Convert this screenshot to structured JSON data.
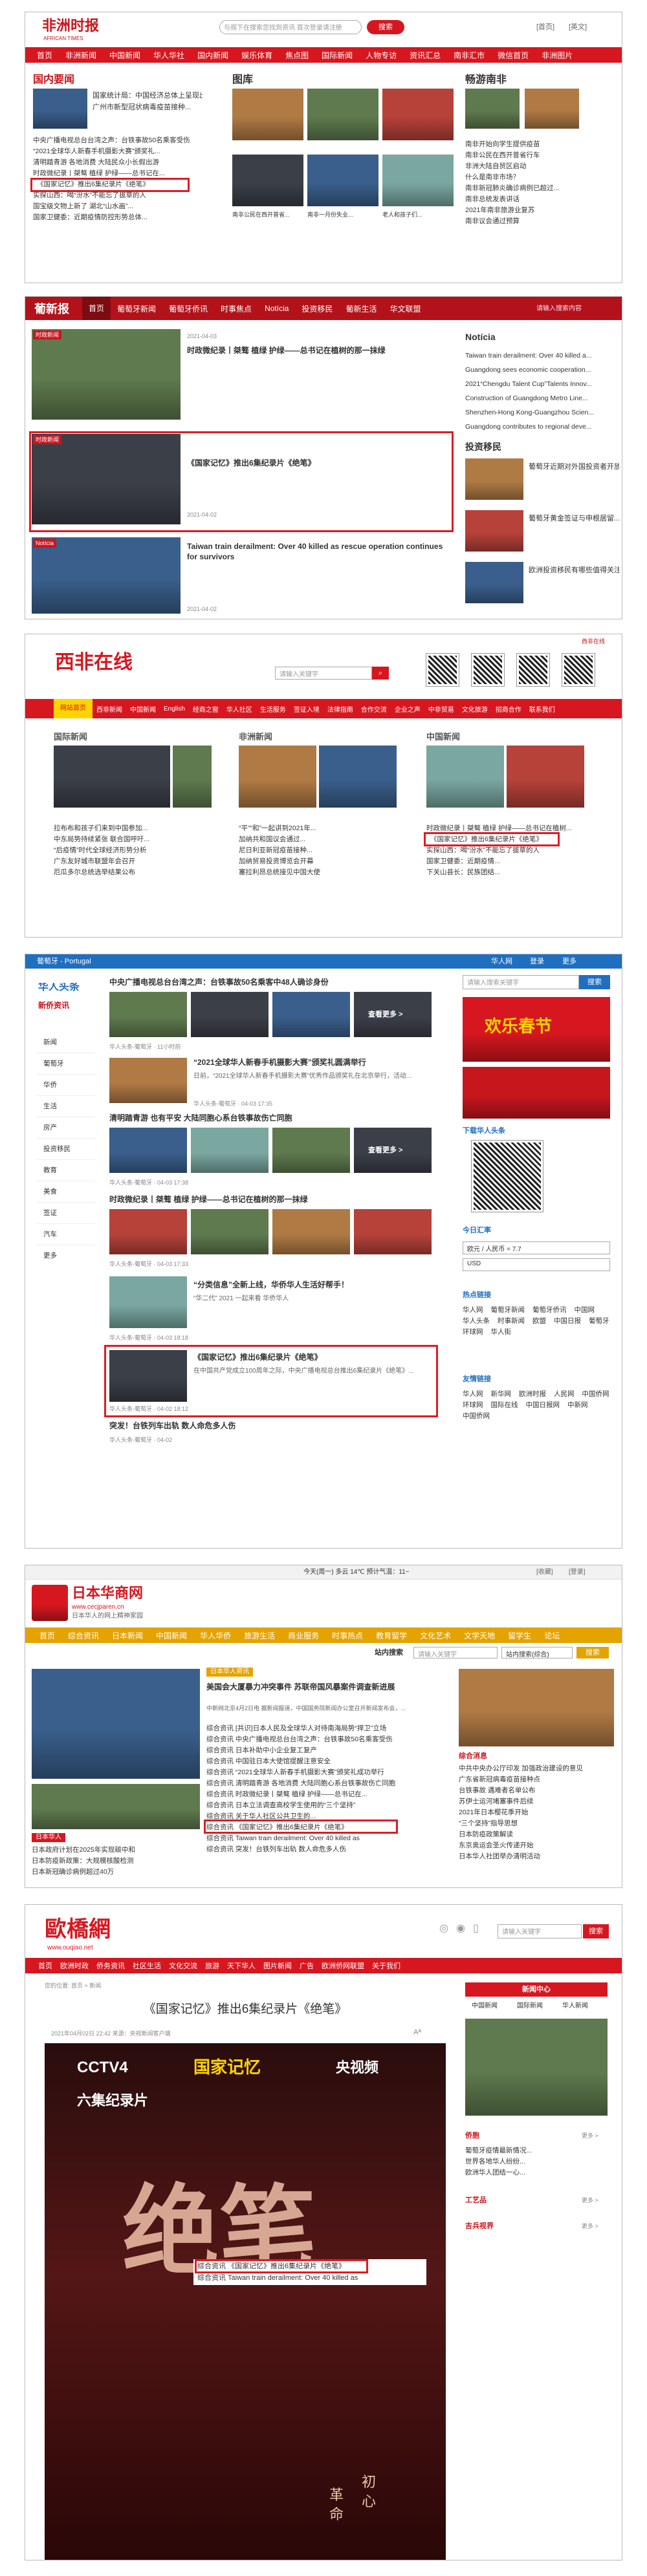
{
  "p1": {
    "logo_cn": "非洲时报",
    "logo_en": "AFRICAN TIMES",
    "search_placeholder": "与阁下在搜索您找到资讯 首次登录请注册",
    "search_btn": "搜索",
    "top_links": [
      "[首页]",
      "[英文]"
    ],
    "nav": [
      "首页",
      "非洲新闻",
      "中国新闻",
      "华人华社",
      "国内新闻",
      "娱乐体育",
      "焦点图",
      "国际新闻",
      "人物专访",
      "资讯汇总",
      "南非汇市",
      "微信首页",
      "非洲图片"
    ],
    "sec_a": "国内要闻",
    "sec_b": "图库",
    "sec_c": "畅游南非",
    "caption_a1": "国家统计局：中国经济总体上呈现出...",
    "caption_a2": "广州市新型冠状病毒疫苗接种...",
    "list_a": [
      "中央广播电视总台台湾之声：台铁事故50名乘客受伤",
      "“2021全球华人新春手机摄影大赛”颁奖礼...",
      "清明踏青游 各地消费 大陆民众小长假出游",
      "时政微纪录丨桀骜 植绿 护绿——总书记在...",
      "《国家记忆》推出6集纪录片《绝笔》",
      "实探山西：喝“汾水”不能忘了拔草的人",
      "国宝级文物上新了 湖北“山水画”...",
      "国家卫健委：近期疫情防控形势总体..."
    ],
    "mid_caps": [
      "南非公民在西开普省...",
      "南非一月份失业...",
      "老人和孩子们..."
    ],
    "list_c": [
      "南非开始向学生提供疫苗",
      "南非公民在西开普省行车",
      "非洲大陆自贸区启动",
      "什么是南非市场？",
      "南非新冠肺炎确诊病例已超过...",
      "南非总统发表讲话",
      "2021年南非旅游业复苏",
      "南非议会通过预算"
    ]
  },
  "p2": {
    "logo": "葡新报",
    "nav": [
      "首页",
      "葡萄牙新闻",
      "葡萄牙侨讯",
      "时事焦点",
      "Notícia",
      "投资移民",
      "葡新生活",
      "华文联盟"
    ],
    "nav_right": "请输入搜索内容",
    "a1_title": "时政微纪录丨桀骜 植绿 护绿——总书记在植树的那一抹绿",
    "a1_date": "2021-04-03",
    "a2_title": "《国家记忆》推出6集纪录片《绝笔》",
    "a2_date": "2021-04-02",
    "a3_title": "Taiwan train derailment: Over 40 killed as rescue operation continues for survivors",
    "a3_date": "2021-04-02",
    "tag_a": "时政新闻",
    "tag_c": "Notícia",
    "side_title": "Notícia",
    "side_list": [
      "Taiwan train derailment: Over 40 killed a...",
      "Guangdong sees economic cooperation...",
      "2021“Chengdu Talent Cup”Talents Innov...",
      "Construction of Guangdong Metro Line...",
      "Shenzhen-Hong Kong-Guangzhou Scien...",
      "Guangdong contributes to regional deve..."
    ],
    "side2_title": "投资移民",
    "side2_list": [
      "葡萄牙近期对外国投资者开放了...",
      "葡萄牙黄金签证与申根居留...",
      "欧洲投资移民有哪些值得关注的..."
    ]
  },
  "p3": {
    "logo": "西非在线",
    "top_tag": "西非在线",
    "search_placeholder": "请输入关键字",
    "nav": [
      "网站首页",
      "西非新闻",
      "中国新闻",
      "English",
      "经商之窗",
      "华人社区",
      "生活服务",
      "签证入境",
      "法律指南",
      "合作交流",
      "企业之声",
      "中非贸易",
      "文化旅游",
      "招商合作",
      "联系我们"
    ],
    "sec_a": "国际新闻",
    "sec_b": "非洲新闻",
    "sec_c": "中国新闻",
    "list_a": [
      "拉布布和孩子们来到中国参加...",
      "中东局势持续紧张 联合国呼吁...",
      "“后疫情”时代全球经济形势分析",
      "广东友好城市联盟年会召开",
      "厄瓜多尔总统选举结果公布"
    ],
    "list_b": [
      "“平”“和”一起讲到2021年...",
      "加纳共和国议会通过...",
      "尼日利亚新冠疫苗接种...",
      "加纳贸易投资博览会开幕",
      "塞拉利昂总统接见中国大使"
    ],
    "list_c": [
      "时政微纪录丨桀骜 植绿 护绿——总书记在植树...",
      "《国家记忆》推出6集纪录片《绝笔》",
      "实探山西：喝“汾水”不能忘了拔草的人",
      "国家卫健委：近期疫情...",
      "下关山县长：民族团结..."
    ]
  },
  "p4": {
    "logo": "葡萄牙 - Portugal",
    "top_right": [
      "华人网",
      "登录",
      "更多"
    ],
    "side_logo": "华人头条",
    "side_logo2": "新侨资讯",
    "side_menu": [
      "新闻",
      "葡萄牙",
      "华侨",
      "生活",
      "房产",
      "投资移民",
      "教育",
      "美食",
      "签证",
      "汽车",
      "更多"
    ],
    "items": [
      {
        "title": "中央广播电视总台台湾之声：台铁事故50名乘客中48人确诊身份",
        "meta": "华人头条-葡萄牙 · 11小时前",
        "more": "查看更多 >"
      },
      {
        "title": "“2021全球华人新春手机摄影大赛”颁奖礼圆满举行",
        "desc": "日前，“2021全球华人新春手机摄影大赛”优秀作品颁奖礼在北京举行，活动...",
        "meta": "华人头条-葡萄牙 · 04-03 17:35"
      },
      {
        "title": "清明踏青游 也有平安 大陆同胞心系台铁事故伤亡同胞",
        "meta": "华人头条-葡萄牙 · 04-03 17:38",
        "more": "查看更多 >"
      },
      {
        "title": "时政微纪录丨桀骜 植绿 护绿——总书记在植树的那一抹绿",
        "meta": "华人头条-葡萄牙 · 04-03 17:33"
      },
      {
        "title": "“华二代” 2021 一起来看 华侨华人",
        "desc": "“分类信息”全新上线，华侨华人生活好帮手！",
        "meta": "华人头条-葡萄牙 · 04-03 18:18"
      },
      {
        "title": "《国家记忆》推出6集纪录片《绝笔》",
        "desc": "在中国共产党成立100周年之际，中央广播电视总台推出6集纪录片《绝笔》...",
        "meta": "华人头条-葡萄牙 · 04-02 18:12"
      },
      {
        "title": "突发！台铁列车出轨 数人命危多人伤",
        "meta": "华人头条-葡萄牙 · 04-02"
      }
    ],
    "search_placeholder": "请输入搜索关键字",
    "search_btn": "搜索",
    "ad_text": "欢乐春节",
    "qr_label": "下载华人头条",
    "rate_title": "今日汇率",
    "rate_rows": [
      "欧元 / 人民币 = 7.7",
      "USD"
    ],
    "hot_title": "热点链接",
    "hot_links": [
      "华人网",
      "葡萄牙新闻",
      "葡萄牙侨讯",
      "中国网",
      "华人头条",
      "时事新闻",
      "欧盟",
      "中国日报",
      "葡萄牙",
      "环球网",
      "华人街"
    ],
    "friend_title": "友情链接",
    "friend_links": [
      "华人网",
      "新华网",
      "欧洲时报",
      "人民网",
      "中国侨网",
      "环球网",
      "国际在线",
      "中国日报网",
      "中新网",
      "中国侨网"
    ]
  },
  "p5": {
    "logo": "日本华商网",
    "logo_url": "www.cecjparen.cn",
    "slogan": "日本华人的网上精神家园",
    "top_text": "今天(周一) 多云 14℃ 预计气温：11~",
    "top_links": [
      "[收藏]",
      "[登录]"
    ],
    "nav": [
      "首页",
      "综合资讯",
      "日本新闻",
      "中国新闻",
      "华人华侨",
      "旅游生活",
      "商业服务",
      "时事热点",
      "教育留学",
      "文化艺术",
      "文学天地",
      "留学生",
      "论坛"
    ],
    "search_label": "站内搜索",
    "search_placeholder": "请输入关键字",
    "search_select": "站内搜索(综合)",
    "search_btn": "搜索",
    "hl_tag": "日本华人资讯",
    "hl_title": "美国会大厦暴力冲突事件 苏联帝国风暴案件调查新进展",
    "hl_desc": "中新网北京4月2日电 据新闻报道，中国国务院新闻办公室召开新闻发布会，...",
    "list": [
      "综合资讯 [共识]日本人民及全球华人对待南海局势“捍卫”立场",
      "综合资讯 中央广播电视总台台湾之声：台铁事故50名乘客受伤",
      "综合资讯 日本补助中小企业复工复产",
      "综合资讯 中国驻日本大使馆提醒注意安全",
      "综合资讯 “2021全球华人新春手机摄影大赛”颁奖礼成功举行",
      "综合资讯 清明踏青游 各地消费 大陆同胞心系台铁事故伤亡同胞",
      "综合资讯 时政微纪录丨桀骜 植绿 护绿——总书记在...",
      "综合资讯 日本立法调查高校学生使用的“三个坚持”",
      "综合资讯 关于华人社区公共卫生的...",
      "综合资讯 《国家记忆》推出6集纪录片《绝笔》",
      "综合资讯 Taiwan train derailment: Over 40 killed as",
      "综合资讯 突发！台铁列车出轨 数人命危多人伤"
    ],
    "side_title": "综合消息",
    "side_list": [
      "中共中央办公厅印发 加强政治建设的意见",
      "广东省新冠病毒疫苗接种点",
      "台铁事故 遇难者名单公布",
      "苏伊士运河堵塞事件后续",
      "2021年日本樱花季开始",
      "“三个坚持”指导思想",
      "日本防疫政策解读",
      "东京奥运会圣火传递开始",
      "日本华人社团举办清明活动"
    ],
    "bl_tag": "日本华人",
    "bl_list": [
      "日本政府计划在2025年实现碳中和",
      "日本防疫新政策：大规模核酸检测",
      "日本新冠确诊病例超过40万"
    ]
  },
  "p6": {
    "logo": "歐橋網",
    "logo_url": "www.ouqiao.net",
    "search_placeholder": "请输入关键字",
    "search_btn": "搜索",
    "nav": [
      "首页",
      "欧洲时政",
      "侨务资讯",
      "社区生活",
      "文化交流",
      "旅游",
      "天下华人",
      "图片新闻",
      "广告",
      "欧洲侨网联盟",
      "关于我们"
    ],
    "breadcrumb": "您的位置: 首页 > 新闻",
    "headline": "《国家记忆》推出6集纪录片《绝笔》",
    "meta": "2021年04月02日 22:42  来源：央视新闻客户端",
    "poster_brand1": "CCTV4",
    "poster_brand2": "国家记忆",
    "poster_brand3": "央视频",
    "poster_sub": "六集纪录片",
    "poster_title": "绝笔",
    "poster_slogan": [
      "革",
      "初",
      "命",
      "心"
    ],
    "overlay_lines": [
      "综合资讯 《国家记忆》推出6集纪录片《绝笔》",
      "综合资讯 Taiwan train derailment: Over 40 killed as"
    ],
    "side_title": "新闻中心",
    "side_tabs": [
      "中国新闻",
      "国际新闻",
      "华人新闻"
    ],
    "side_sec": [
      "侨胞",
      "工艺品",
      "吉兵视界"
    ],
    "more": "更多 >",
    "side_items": [
      "葡萄牙疫情最新情况...",
      "世界各地华人纷纷...",
      "欧洲华人团结一心..."
    ]
  }
}
